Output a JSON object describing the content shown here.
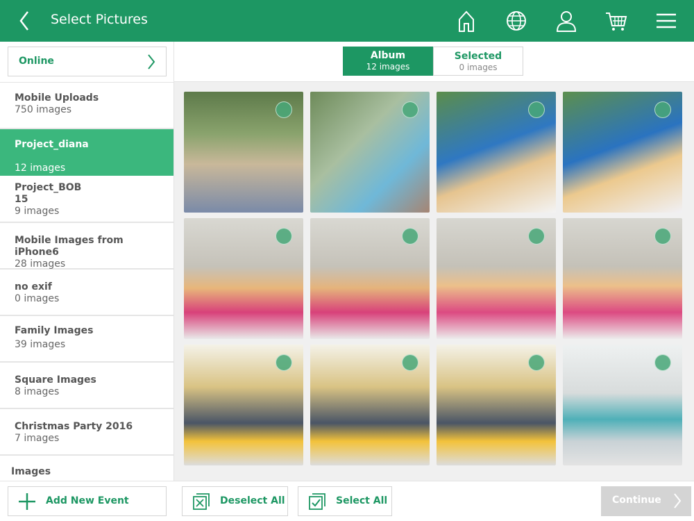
{
  "header": {
    "title": "Select Pictures",
    "icons": [
      "back-chevron-icon",
      "home-icon",
      "globe-icon",
      "user-icon",
      "cart-icon",
      "menu-icon"
    ]
  },
  "sidebar": {
    "source_label": "Online",
    "events": [
      {
        "name": "Mobile Uploads",
        "count": "750 images"
      },
      {
        "name": "Project_diana",
        "count": "12 images",
        "active": true
      },
      {
        "name": "Project_BOB\n15",
        "count": "9 images"
      },
      {
        "name": "Mobile Images from iPhone6",
        "count": "28 images"
      },
      {
        "name": "no exif",
        "count": "0 images"
      },
      {
        "name": "Family Images",
        "count": "39 images"
      },
      {
        "name": "Square Images",
        "count": "8 images"
      },
      {
        "name": "Christmas Party 2016",
        "count": "7 images"
      }
    ],
    "images_header": "Images"
  },
  "tabs": {
    "album": {
      "label": "Album",
      "count": "12 images"
    },
    "selected": {
      "label": "Selected",
      "count": "0 images"
    }
  },
  "photos": [
    {
      "scene": "family-on-tree"
    },
    {
      "scene": "dad-and-toddler"
    },
    {
      "scene": "dad-and-boy-icecream"
    },
    {
      "scene": "dad-and-boy-icecream-close"
    },
    {
      "scene": "girl-drinking-milk"
    },
    {
      "scene": "girl-drinking-milk-2"
    },
    {
      "scene": "girl-smiling-milk"
    },
    {
      "scene": "girl-smiling-milk-2"
    },
    {
      "scene": "boy-eating"
    },
    {
      "scene": "boy-eating-2"
    },
    {
      "scene": "boy-eating-3"
    },
    {
      "scene": "girl-at-sink"
    }
  ],
  "footer": {
    "add_event": "Add New Event",
    "deselect_all": "Deselect All",
    "select_all": "Select All",
    "continue": "Continue"
  },
  "colors": {
    "brand_green": "#1d9763",
    "active_row": "#3bb77d",
    "disabled": "#d4d4d4"
  }
}
